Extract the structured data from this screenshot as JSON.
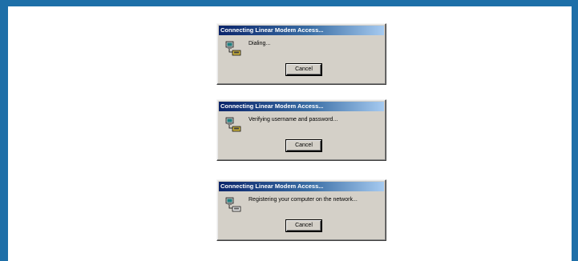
{
  "dialogs": [
    {
      "title": "Connecting Linear Modem Access...",
      "status": "Dialing...",
      "cancel_label": "Cancel",
      "icon": "dialup-computer-icon"
    },
    {
      "title": "Connecting Linear Modem Access...",
      "status": "Verifying username and password...",
      "cancel_label": "Cancel",
      "icon": "dialup-computer-icon"
    },
    {
      "title": "Connecting Linear Modem Access...",
      "status": "Registering your computer on the network...",
      "cancel_label": "Cancel",
      "icon": "dialup-computer-icon"
    }
  ],
  "colors": {
    "border": "#1e6fa8",
    "titlebar_start": "#0a246a",
    "titlebar_end": "#a6caf0",
    "dialog_face": "#d4d0c8"
  }
}
